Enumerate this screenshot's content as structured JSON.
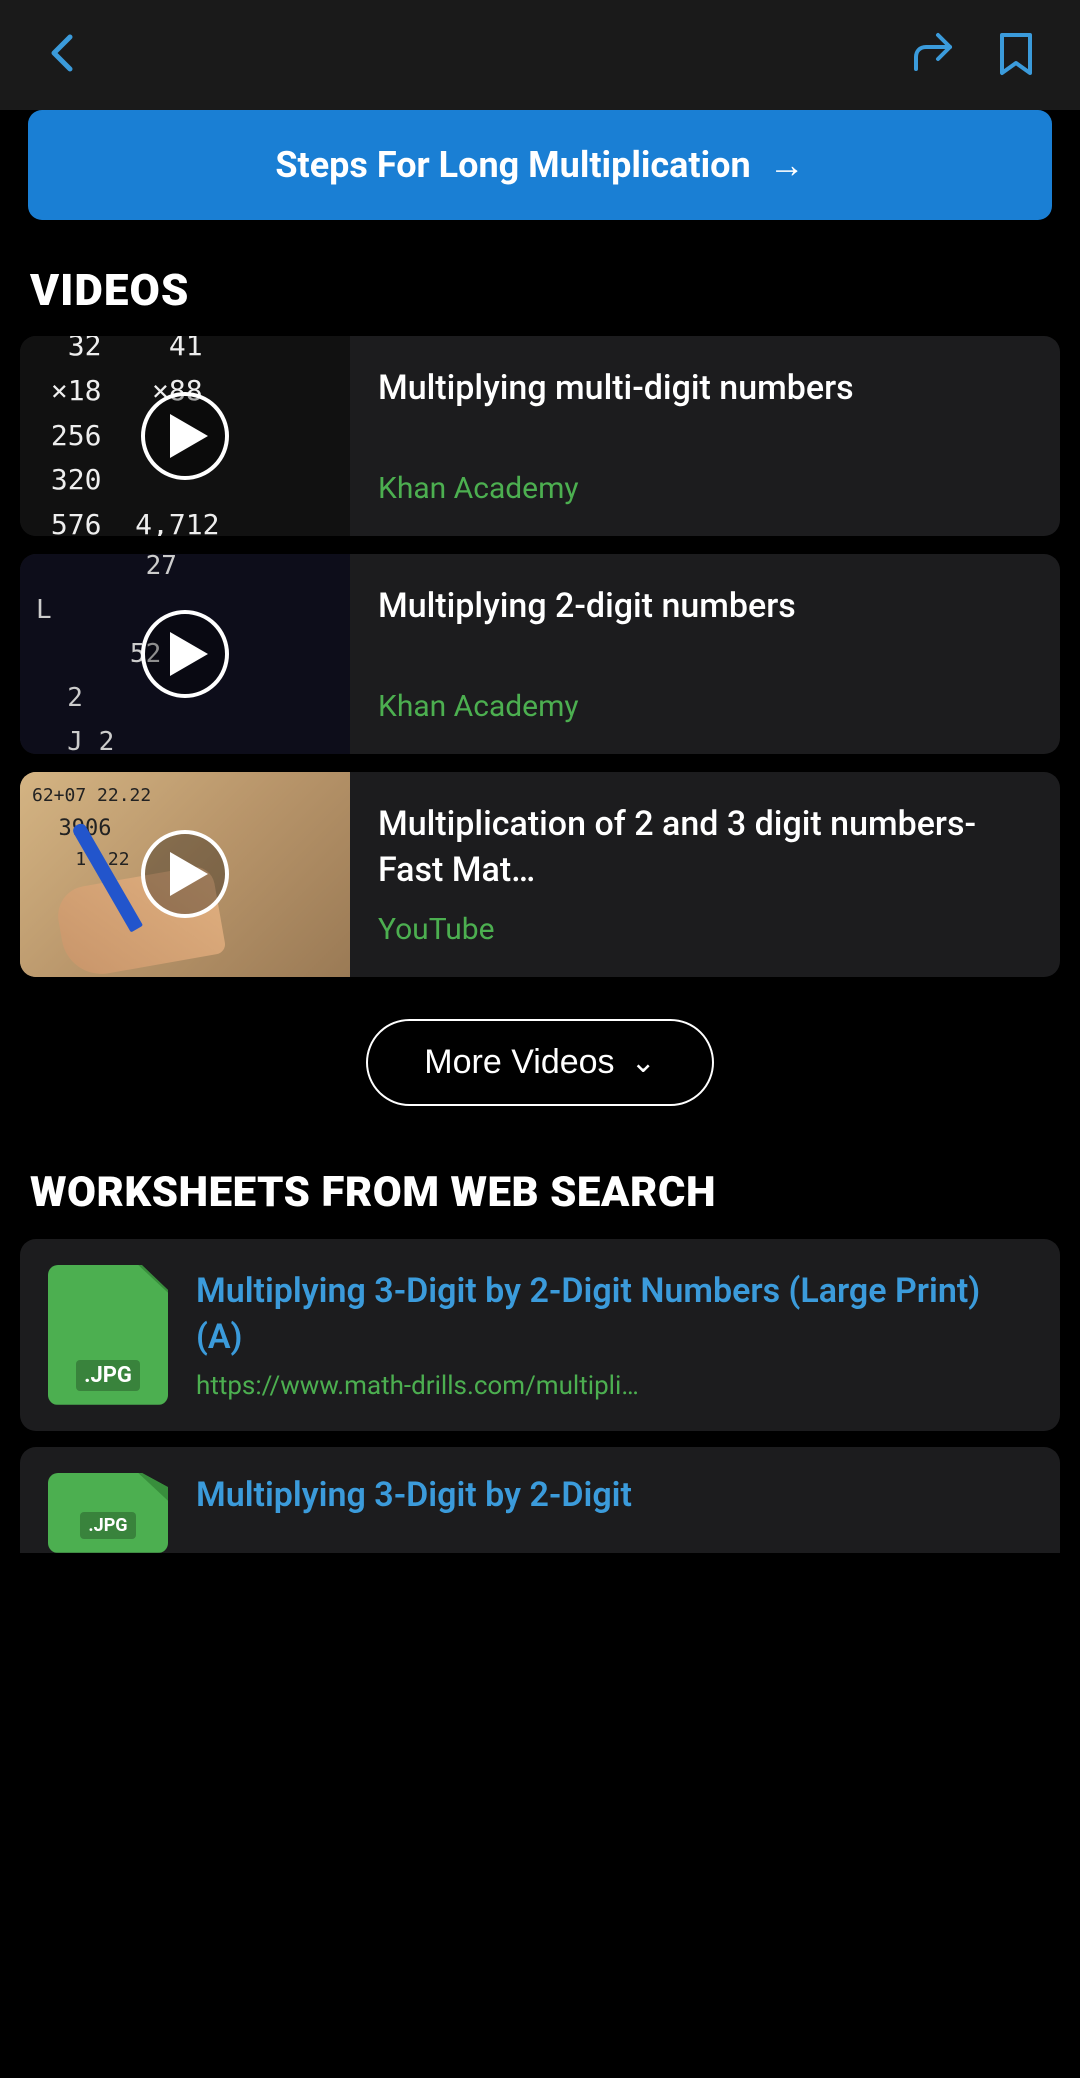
{
  "topBar": {
    "backIcon": "back-chevron",
    "shareIcon": "share-icon",
    "bookmarkIcon": "bookmark-icon"
  },
  "heroButton": {
    "label": "Steps For Long Multiplication",
    "arrow": "→"
  },
  "videos": {
    "sectionTitle": "VIDEOS",
    "items": [
      {
        "title": "Multiplying multi-digit numbers",
        "source": "Khan Academy",
        "thumbType": "math1"
      },
      {
        "title": "Multiplying 2-digit numbers",
        "source": "Khan Academy",
        "thumbType": "math2"
      },
      {
        "title": "Multiplication of 2 and 3 digit numbers-Fast Mat…",
        "source": "YouTube",
        "thumbType": "youtube"
      }
    ],
    "moreButton": "More Videos"
  },
  "worksheets": {
    "sectionTitle": "WORKSHEETS FROM WEB SEARCH",
    "items": [
      {
        "title": "Multiplying 3-Digit by 2-Digit Numbers (Large Print) (A)",
        "url": "https://www.math-drills.com/multipli…",
        "fileType": ".JPG"
      },
      {
        "title": "Multiplying 3-Digit by 2-Digit",
        "url": "",
        "fileType": ".JPG"
      }
    ]
  },
  "mathLines1": [
    "   32    41",
    " ×18    ×88",
    "  256",
    "  320",
    "  576  4,712"
  ],
  "mathLines2": [
    "        27",
    "   ×    52",
    "  ×  2",
    "    J 2"
  ]
}
